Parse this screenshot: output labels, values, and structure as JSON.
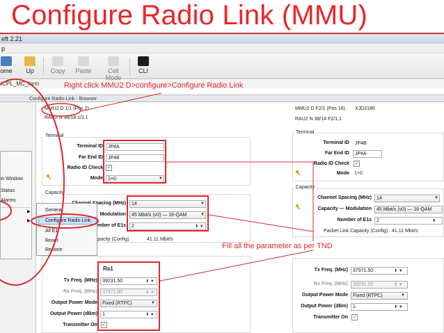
{
  "slide": {
    "title": "Configure Radio Link (MMU)",
    "note_top": "Right click MMU2 D>configure>Configure Radio Link",
    "note_bottom": "Fill all the parameter as per TND"
  },
  "window": {
    "title_fragment": "eft 2.21",
    "menu_fragment": "p"
  },
  "toolbar": {
    "home_label": "ome",
    "up_label": "Up",
    "copy_label": "Copy",
    "paste_label": "Paste",
    "cellmode_label": "Cell Mode",
    "cli_label": "CLI"
  },
  "pathbar": {
    "text": "ICPL_MC_form"
  },
  "browser": {
    "tab_title": "Configure Radio Link - Browser"
  },
  "context_menu": {
    "items": [
      "w Window",
      "Status",
      "Alarms"
    ],
    "submenu": [
      "General",
      "Configure Radio Link",
      "All E1",
      "Reset",
      "Restore"
    ]
  },
  "left_panel": {
    "header1": "MMU2 D 1/1 (Pos 2)",
    "header2": "RAU2 N 38/18 1/2.1",
    "terminal_group": "Terminal",
    "terminal_id_label": "Terminal ID",
    "terminal_id": "JP4A",
    "far_end_id_label": "Far End ID",
    "far_end_id": "JP4B",
    "radio_id_check_label": "Radio ID Check",
    "mode_label": "Mode",
    "mode": "1+0",
    "capacity_group": "Capacity",
    "channel_spacing_label": "Channel Spacing (MHz)",
    "channel_spacing": "14",
    "modulation_label": "Modulation",
    "modulation": "45 Mbit/s (v0) — 16-QAM",
    "num_e1_label": "Number of E1s",
    "num_e1": "2",
    "link_capacity_label": "k Capacity (Config)",
    "link_capacity": "41.11 Mbit/s",
    "ra_group": "Ra1",
    "tx_label": "Tx Freq. (MHz)",
    "tx": "39231.50",
    "rx_label": "Rx Freq. (MHz)",
    "rx": "37971.50",
    "out_mode_label": "Output Power Mode",
    "out_mode": "Fixed (RTPC)",
    "out_dbm_label": "Output Power (dBm)",
    "out_dbm": "1",
    "tx_on_label": "Transmitter On"
  },
  "right_panel": {
    "header1": "MMU2 D F2/1 (Pos 16)",
    "header1_id": "XJD2186",
    "header2": "RAU2 N 38/14 F2/1.1",
    "terminal_group": "Terminal",
    "terminal_id_label": "Terminal ID",
    "terminal_id": "JP4B",
    "far_end_id_label": "Far End ID",
    "far_end_id": "JP4A",
    "radio_id_check_label": "Radio ID Check",
    "mode_label": "Mode",
    "mode": "1+0",
    "capacity_group": "Capacity",
    "channel_spacing_label": "Channel Spacing (MHz)",
    "channel_spacing": "14",
    "modulation_label": "Capacity — Modulation",
    "modulation": "45 Mbit/s (v0) — 16-QAM",
    "num_e1_label": "Number of E1s",
    "num_e1": "2",
    "link_capacity_label": "Packet Link Capacity (Config)",
    "link_capacity": "41.11 Mbit/s",
    "tx_label": "Tx Freq. (MHz)",
    "tx": "37971.50",
    "rx_label": "Rx Freq. (MHz)",
    "rx": "39231.50",
    "out_mode_label": "Output Power Mode",
    "out_mode": "Fixed (RTPC)",
    "out_dbm_label": "Output Power (dBm)",
    "out_dbm": "1",
    "tx_on_label": "Transmitter On"
  },
  "colors": {
    "annotation": "#e0262b",
    "title": "#e8262a"
  },
  "icons": [
    "home-icon",
    "up-folder-icon",
    "copy-icon",
    "paste-icon",
    "cell-mode-icon",
    "cli-icon",
    "key-icon",
    "check-icon",
    "dropdown-arrow-icon",
    "spinner-icon"
  ]
}
